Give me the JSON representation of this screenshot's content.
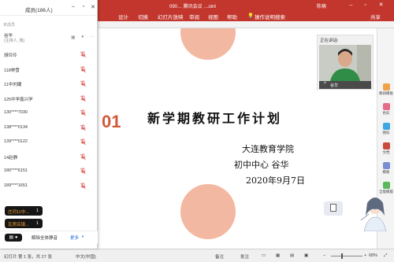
{
  "window": {
    "title": "090…  腾讯会议  …oint",
    "user": "陈楠",
    "share_label": "共享"
  },
  "ribbon": {
    "tabs": [
      "设计",
      "切换",
      "幻灯片放映",
      "审阅",
      "视图",
      "帮助"
    ],
    "search": "操作说明搜索"
  },
  "panel": {
    "title": "成员(186人)",
    "section_label": "未成员",
    "host": {
      "name": "谷华",
      "role": "(主持人, 我)"
    },
    "members": [
      "胡玲玲",
      "118林雪",
      "11中刘婕",
      "125中学鑫兴学",
      "130****7030",
      "138****0134",
      "139****0122",
      "14赵静",
      "180****6151",
      "189****1651"
    ],
    "toasts": [
      {
        "text": "庄河11中...",
        "count": "1"
      },
      {
        "text": "瓦房店镇...",
        "count": "1"
      }
    ],
    "bottom": {
      "mute_all": "解除全体静音",
      "more": "更多"
    }
  },
  "slide": {
    "number": "01",
    "title": "新学期教研工作计划",
    "org": "大连教育学院",
    "dept_person": "初中中心   谷华",
    "date": "2020年9月7日"
  },
  "video": {
    "label": "正在讲话:",
    "speaker": "谷华"
  },
  "right_pane": {
    "items": [
      "教研模板",
      "色彩",
      "图标",
      "文档",
      "模板",
      "全能模版"
    ]
  },
  "status": {
    "slide_count": "幻灯片 第 1 张，共 27 张",
    "language": "中文(中国)",
    "notes": "备注",
    "comments": "批注",
    "zoom": "68%"
  },
  "colors": {
    "accent": "#c2362d",
    "circle": "#f3b8a1"
  }
}
